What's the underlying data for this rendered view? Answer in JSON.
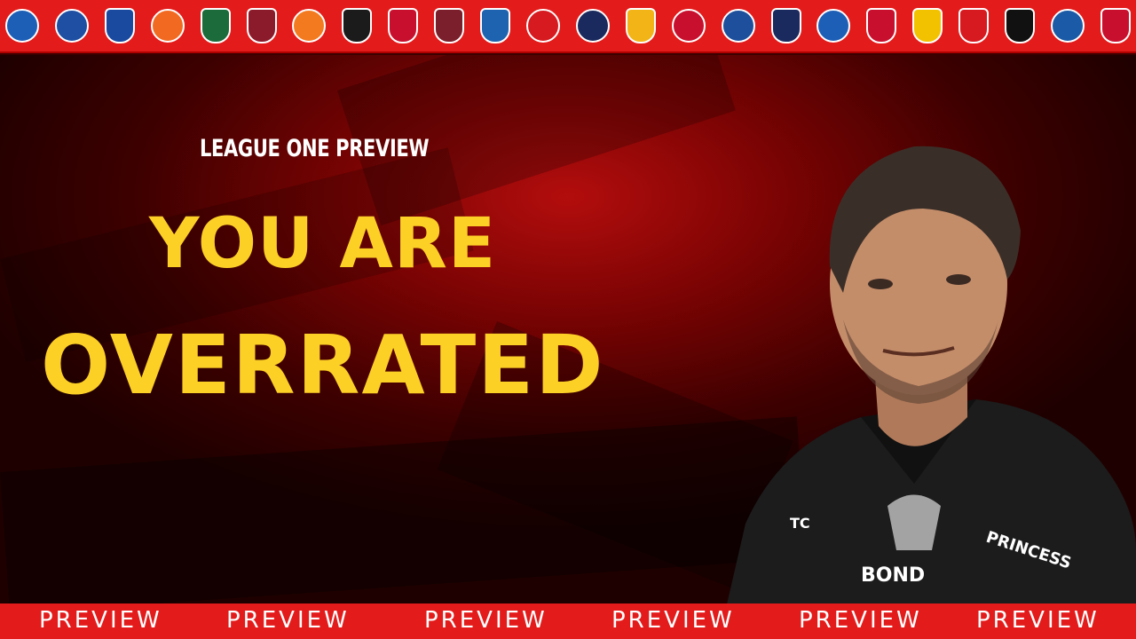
{
  "header": {
    "crests": [
      {
        "name": "peterborough-crest",
        "color": "#1d5fb7",
        "round": true
      },
      {
        "name": "stockport-crest",
        "color": "#1e4fa3",
        "round": true
      },
      {
        "name": "cardiff-crest",
        "color": "#1a4aa0",
        "round": false
      },
      {
        "name": "luton-crest",
        "color": "#f26a21",
        "round": true
      },
      {
        "name": "plymouth-crest",
        "color": "#1c6b3a",
        "round": false
      },
      {
        "name": "northampton-crest",
        "color": "#8b1b2b",
        "round": false
      },
      {
        "name": "blackpool-crest",
        "color": "#f47a20",
        "round": true
      },
      {
        "name": "exeter-crest",
        "color": "#1b1b1b",
        "round": false
      },
      {
        "name": "rotherham-crest",
        "color": "#c8102e",
        "round": false
      },
      {
        "name": "bradford-crest",
        "color": "#7a1f2b",
        "round": false
      },
      {
        "name": "huddersfield-crest",
        "color": "#1e63b0",
        "round": false
      },
      {
        "name": "leyton-orient-crest",
        "color": "#d71920",
        "round": true
      },
      {
        "name": "bolton-crest",
        "color": "#1b2a5e",
        "round": true
      },
      {
        "name": "mansfield-crest",
        "color": "#f2b417",
        "round": false
      },
      {
        "name": "stevenage-crest",
        "color": "#c8102e",
        "round": true
      },
      {
        "name": "reading-crest",
        "color": "#1d4f9c",
        "round": true
      },
      {
        "name": "afc-wimbledon-crest",
        "color": "#1b2a5e",
        "round": false
      },
      {
        "name": "wigan-crest",
        "color": "#1d5fb7",
        "round": true
      },
      {
        "name": "doncaster-crest",
        "color": "#c8102e",
        "round": false
      },
      {
        "name": "burton-crest",
        "color": "#f2c200",
        "round": false
      },
      {
        "name": "lincoln-crest",
        "color": "#d71920",
        "round": false
      },
      {
        "name": "bromley-crest",
        "color": "#111111",
        "round": false
      },
      {
        "name": "wycombe-crest",
        "color": "#1b5aa6",
        "round": true
      },
      {
        "name": "barnsley-crest",
        "color": "#c8102e",
        "round": false
      }
    ]
  },
  "hero": {
    "kicker": "LEAGUE ONE PREVIEW",
    "headline_line1": "YOU ARE",
    "headline_line2": "OVERRATED"
  },
  "footer": {
    "items": [
      "PREVIEW",
      "PREVIEW",
      "PREVIEW",
      "PREVIEW",
      "PREVIEW",
      "PREVIEW"
    ]
  },
  "colors": {
    "accent": "#fdd026",
    "bar": "#e31b1b",
    "background": "#3a0000"
  }
}
